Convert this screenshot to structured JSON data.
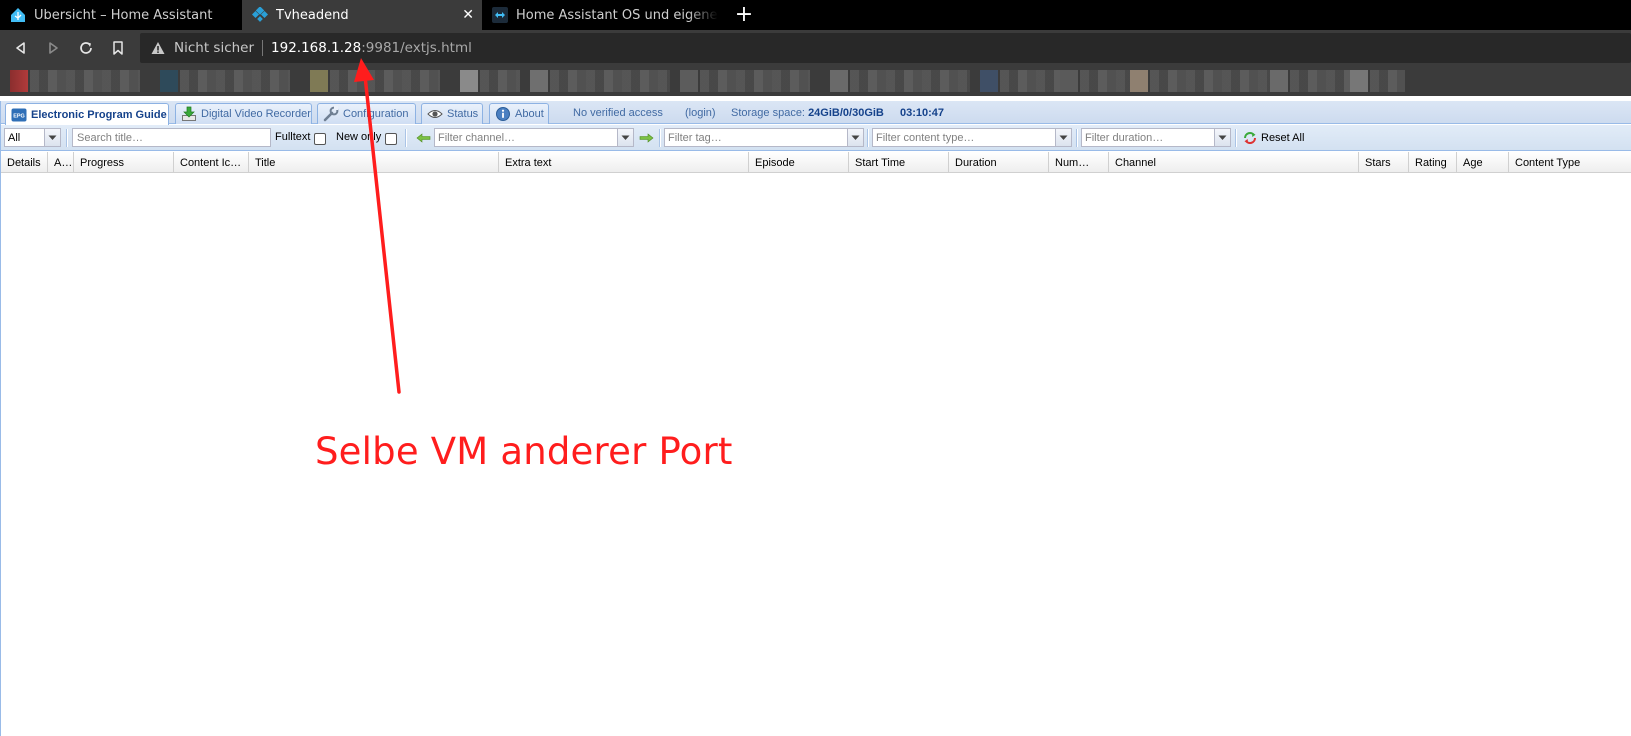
{
  "browser": {
    "tabs": [
      {
        "title": "Übersicht – Home Assistant",
        "icon": "home-assistant-icon",
        "active": false
      },
      {
        "title": "Tvheadend",
        "icon": "tvheadend-icon",
        "active": true,
        "close": "✕"
      },
      {
        "title": "Home Assistant OS und eigene Do",
        "icon": "forum-icon",
        "active": false
      }
    ],
    "new_tab": "+",
    "url": {
      "security": "Nicht sicher",
      "host": "192.168.1.28",
      "path": ":9981/extjs.html"
    }
  },
  "tvh": {
    "tabs": [
      {
        "label": "Electronic Program Guide",
        "icon": "epg-icon",
        "active": true
      },
      {
        "label": "Digital Video Recorder",
        "icon": "download-icon",
        "active": false
      },
      {
        "label": "Configuration",
        "icon": "wrench-icon",
        "active": false
      },
      {
        "label": "Status",
        "icon": "eye-icon",
        "active": false
      },
      {
        "label": "About",
        "icon": "info-icon",
        "active": false
      }
    ],
    "status": {
      "access": "No verified access",
      "login": "(login)",
      "storage_label": "Storage space:",
      "storage_value": "24GiB/0/30GiB",
      "time": "03:10:47"
    },
    "toolbar": {
      "mode_value": "All",
      "search_placeholder": "Search title…",
      "fulltext_label": "Fulltext",
      "new_only_label": "New only",
      "channel_placeholder": "Filter channel…",
      "tag_placeholder": "Filter tag…",
      "content_type_placeholder": "Filter content type…",
      "duration_placeholder": "Filter duration…",
      "reset_label": "Reset All"
    },
    "columns": [
      "Details",
      "A…",
      "Progress",
      "Content Ic…",
      "Title",
      "Extra text",
      "Episode",
      "Start Time",
      "Duration",
      "Num…",
      "Channel",
      "Stars",
      "Rating",
      "Age",
      "Content Type"
    ]
  },
  "annotation": {
    "text": "Selbe VM anderer Port",
    "color": "#ff1d1d"
  }
}
